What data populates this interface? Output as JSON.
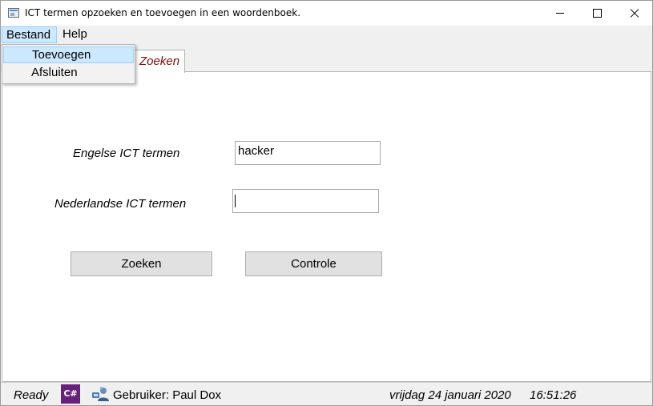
{
  "window": {
    "title": "ICT termen opzoeken en toevoegen in een woordenboek."
  },
  "menubar": {
    "items": [
      {
        "label": "Bestand"
      },
      {
        "label": "Help"
      }
    ]
  },
  "dropdown": {
    "items": [
      {
        "label": "Toevoegen"
      },
      {
        "label": "Afsluiten"
      }
    ]
  },
  "tabs": {
    "active": "Zoeken"
  },
  "form": {
    "english_label": "Engelse ICT termen",
    "english_value": "hacker",
    "dutch_label": "Nederlandse ICT termen",
    "dutch_value": "",
    "search_button": "Zoeken",
    "check_button": "Controle"
  },
  "statusbar": {
    "ready": "Ready",
    "csharp_badge": "C#",
    "user": "Gebruiker: Paul Dox",
    "date": "vrijdag 24 januari 2020",
    "time": "16:51:26"
  },
  "colors": {
    "tab_text": "#7a0a0a",
    "menu_highlight": "#cce8ff",
    "csharp_badge": "#68217a"
  },
  "icons": [
    "app-window-icon",
    "minimize-icon",
    "maximize-icon",
    "close-icon",
    "csharp-icon",
    "user-network-icon"
  ]
}
